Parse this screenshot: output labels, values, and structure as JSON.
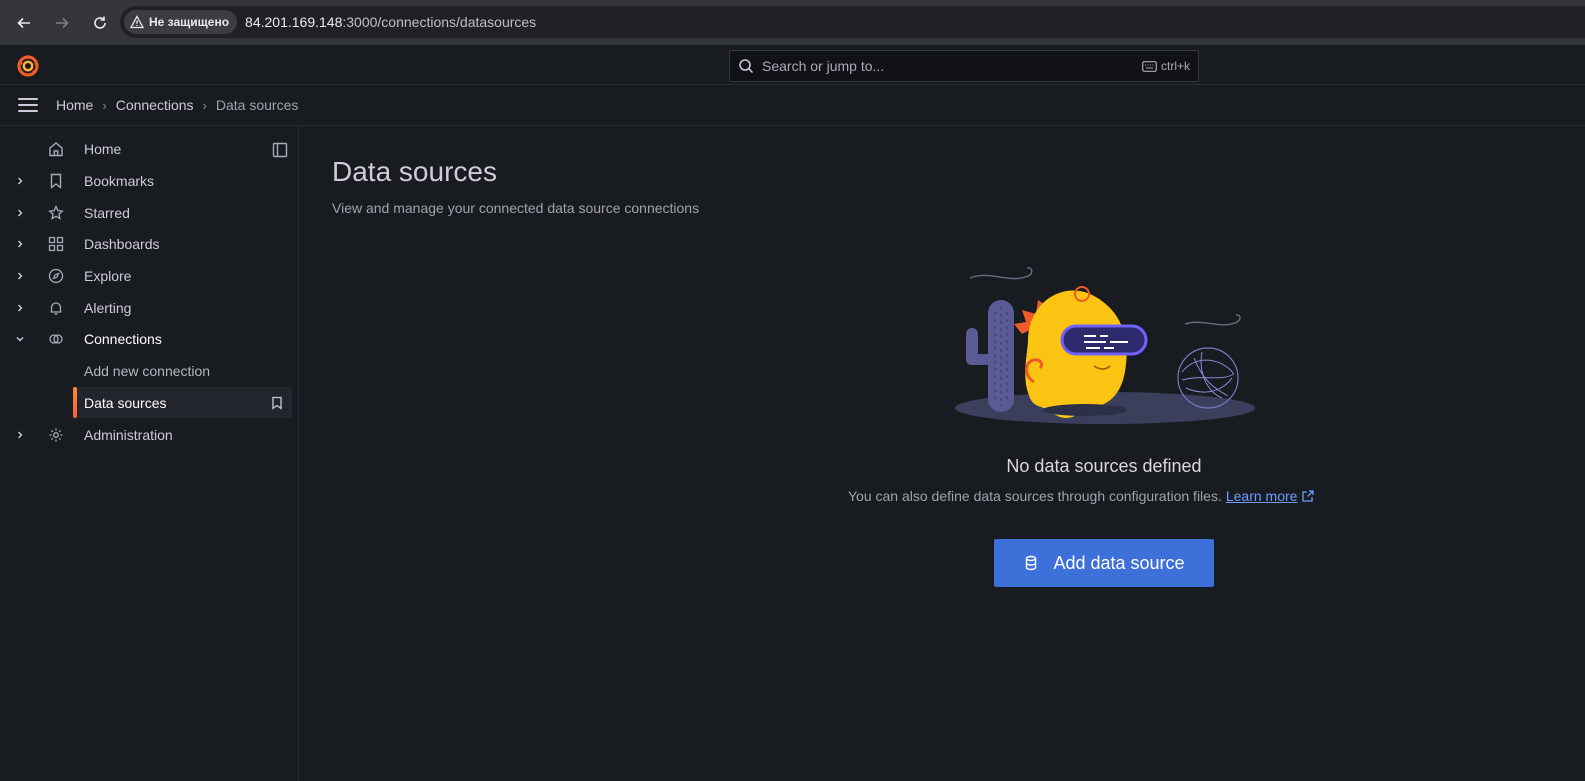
{
  "browser": {
    "security_label": "Не защищено",
    "url_host": "84.201.169.148",
    "url_rest": ":3000/connections/datasources"
  },
  "topbar": {
    "search_placeholder": "Search or jump to...",
    "shortcut": "ctrl+k"
  },
  "breadcrumb": {
    "items": [
      "Home",
      "Connections",
      "Data sources"
    ]
  },
  "sidebar": {
    "items": [
      {
        "label": "Home",
        "icon": "home-icon"
      },
      {
        "label": "Bookmarks",
        "icon": "bookmark-icon"
      },
      {
        "label": "Starred",
        "icon": "star-icon"
      },
      {
        "label": "Dashboards",
        "icon": "apps-icon"
      },
      {
        "label": "Explore",
        "icon": "compass-icon"
      },
      {
        "label": "Alerting",
        "icon": "bell-icon"
      },
      {
        "label": "Connections",
        "icon": "link-icon"
      },
      {
        "label": "Add new connection",
        "icon": ""
      },
      {
        "label": "Data sources",
        "icon": ""
      },
      {
        "label": "Administration",
        "icon": "cog-icon"
      }
    ]
  },
  "main": {
    "title": "Data sources",
    "subtitle": "View and manage your connected data source connections",
    "empty_title": "No data sources defined",
    "empty_text": "You can also define data sources through configuration files.",
    "learn_more": "Learn more",
    "add_button": "Add data source"
  },
  "colors": {
    "background": "#181b1f",
    "accent": "#3d71d9",
    "active_marker": "#ff8833",
    "link": "#6e9fff"
  }
}
